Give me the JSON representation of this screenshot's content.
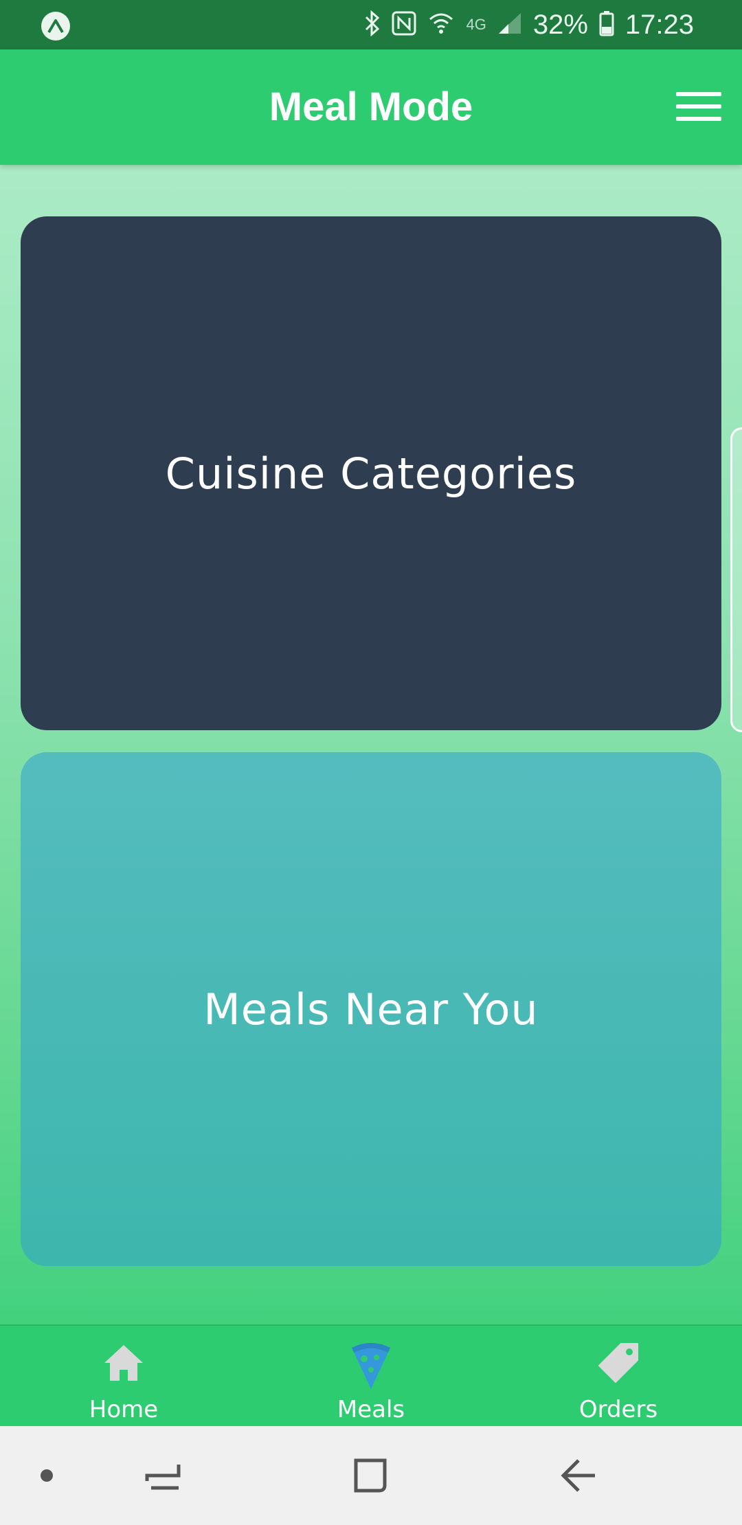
{
  "status_bar": {
    "network": "4G",
    "battery": "32%",
    "time": "17:23"
  },
  "app_bar": {
    "title": "Meal Mode",
    "menu_icon": "hamburger-menu-icon"
  },
  "cards": [
    {
      "label": "Cuisine Categories",
      "color": "#2e3e50"
    },
    {
      "label": "Meals Near You",
      "color": "#47b8b5"
    }
  ],
  "tab_bar": {
    "background": "#2ecc71",
    "active_color": "#3498db",
    "inactive_color": "#d9d9d9",
    "tabs": [
      {
        "label": "Home",
        "icon": "home-icon",
        "active": false
      },
      {
        "label": "Meals",
        "icon": "pizza-icon",
        "active": true
      },
      {
        "label": "Orders",
        "icon": "tag-icon",
        "active": false
      }
    ]
  },
  "nav_bar": {
    "items": [
      "dot-icon",
      "recent-apps-icon",
      "home-square-icon",
      "back-icon"
    ]
  },
  "colors": {
    "status_bar": "#1f7a40",
    "app_bar": "#2ecc71",
    "gradient_top": "#abebc6",
    "gradient_bottom": "#43d17e"
  }
}
